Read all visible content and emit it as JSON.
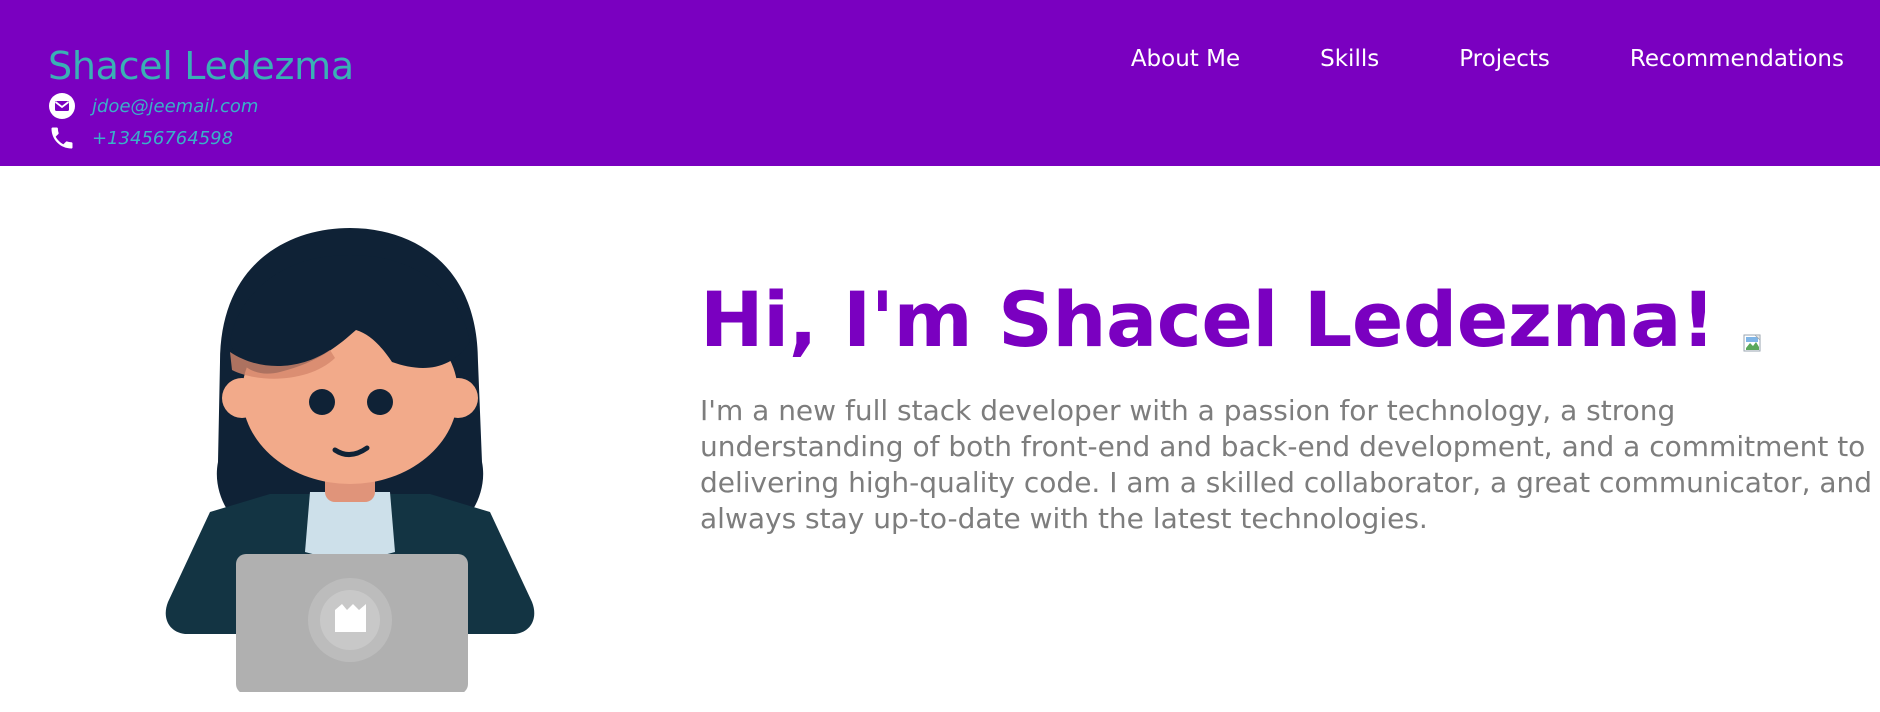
{
  "header": {
    "brand": "Shacel Ledezma",
    "email": "jdoe@jeemail.com",
    "phone": "+13456764598",
    "email_icon": "envelope-icon",
    "phone_icon": "phone-icon",
    "nav": [
      {
        "label": "About Me"
      },
      {
        "label": "Skills"
      },
      {
        "label": "Projects"
      },
      {
        "label": "Recommendations"
      }
    ]
  },
  "hero": {
    "title": "Hi, I'm Shacel Ledezma!",
    "description": "I'm a new full stack developer with a passion for technology, a strong understanding of both front-end and back-end development, and a commitment to delivering high-quality code. I am a skilled collaborator, a great communicator, and always stay up-to-date with the latest technologies.",
    "avatar_icon": "developer-avatar-illustration",
    "wave_image_icon": "broken-image-icon"
  },
  "colors": {
    "header_bg": "#7a00c0",
    "brand": "#3ab0b5",
    "title": "#7a00c0",
    "text": "#7d7d7d"
  }
}
